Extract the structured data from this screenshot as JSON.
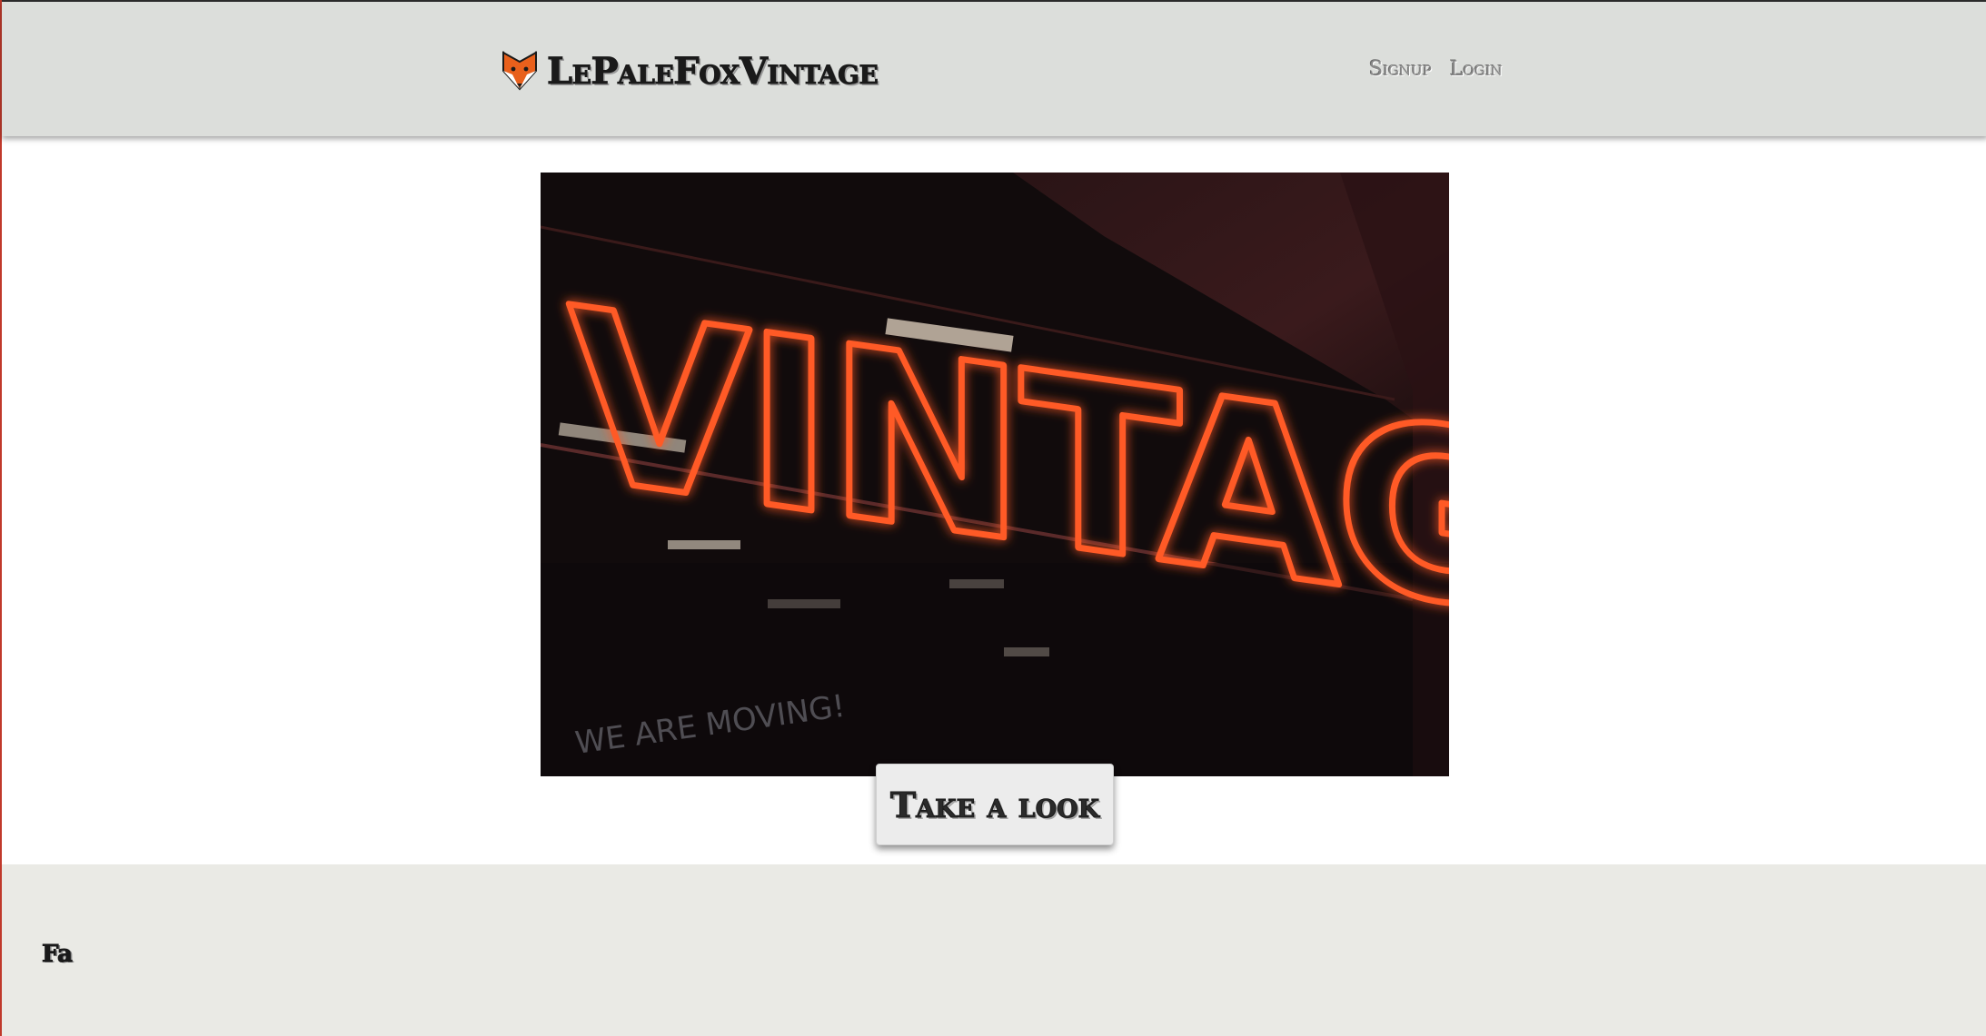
{
  "header": {
    "brand": "LePaleFoxVintage",
    "brand_icon": "fox-icon",
    "nav": {
      "signup_label": "Signup",
      "login_label": "Login"
    }
  },
  "hero": {
    "image_subject": "neon sign photo",
    "sign_text": "VINTAGE",
    "window_text": "WE ARE MOVING!"
  },
  "cta": {
    "label": "Take a look"
  },
  "footer": {
    "logo_text": "Fa"
  },
  "colors": {
    "header_bg": "#dcdedb",
    "footer_bg": "#eaeae5",
    "neon": "#ff4a1c",
    "fox_orange": "#e8601c"
  }
}
